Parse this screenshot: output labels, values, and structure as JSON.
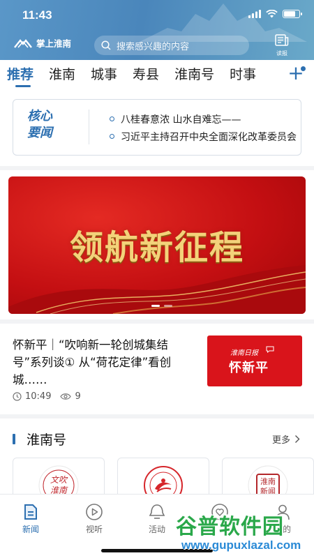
{
  "status_bar": {
    "time": "11:43"
  },
  "header": {
    "app_name": "掌上淮南",
    "search_placeholder": "搜索感兴趣的内容",
    "read_paper_label": "读报",
    "brand_color": "#4a86bb"
  },
  "tabs": {
    "items": [
      "推荐",
      "淮南",
      "城事",
      "寿县",
      "淮南号",
      "时事"
    ],
    "active_index": 0,
    "accent_color": "#2c6fb0"
  },
  "core_news": {
    "badge_line1": "核心",
    "badge_line2": "要闻",
    "headlines": [
      "八桂春意浓 山水自难忘——",
      "习近平主持召开中央全面深化改革委员会"
    ]
  },
  "banner": {
    "title": "领航新征程",
    "slide_count": 2,
    "active_slide": 0
  },
  "article": {
    "title": "怀新平｜“吹响新一轮创城集结号”系列谈① 从“荷花定律”看创城……",
    "time": "10:49",
    "views": "9",
    "thumb_paper": "淮南日报",
    "thumb_column": "怀新平"
  },
  "huainan_hao": {
    "title": "淮南号",
    "more_label": "更多",
    "cards": [
      {
        "logo_text": "文吹淮南",
        "logo_color": "#c0272d"
      },
      {
        "logo_text": "淮南师范学院",
        "logo_color": "#d6262b"
      },
      {
        "logo_text": "淮南新闻",
        "logo_color": "#b3262a"
      }
    ]
  },
  "bottom_nav": {
    "items": [
      "新闻",
      "视听",
      "活动",
      "",
      "我的"
    ],
    "active_index": 0
  },
  "watermark": {
    "main": "谷普软件园",
    "url": "www.gupuxlazal.com"
  }
}
